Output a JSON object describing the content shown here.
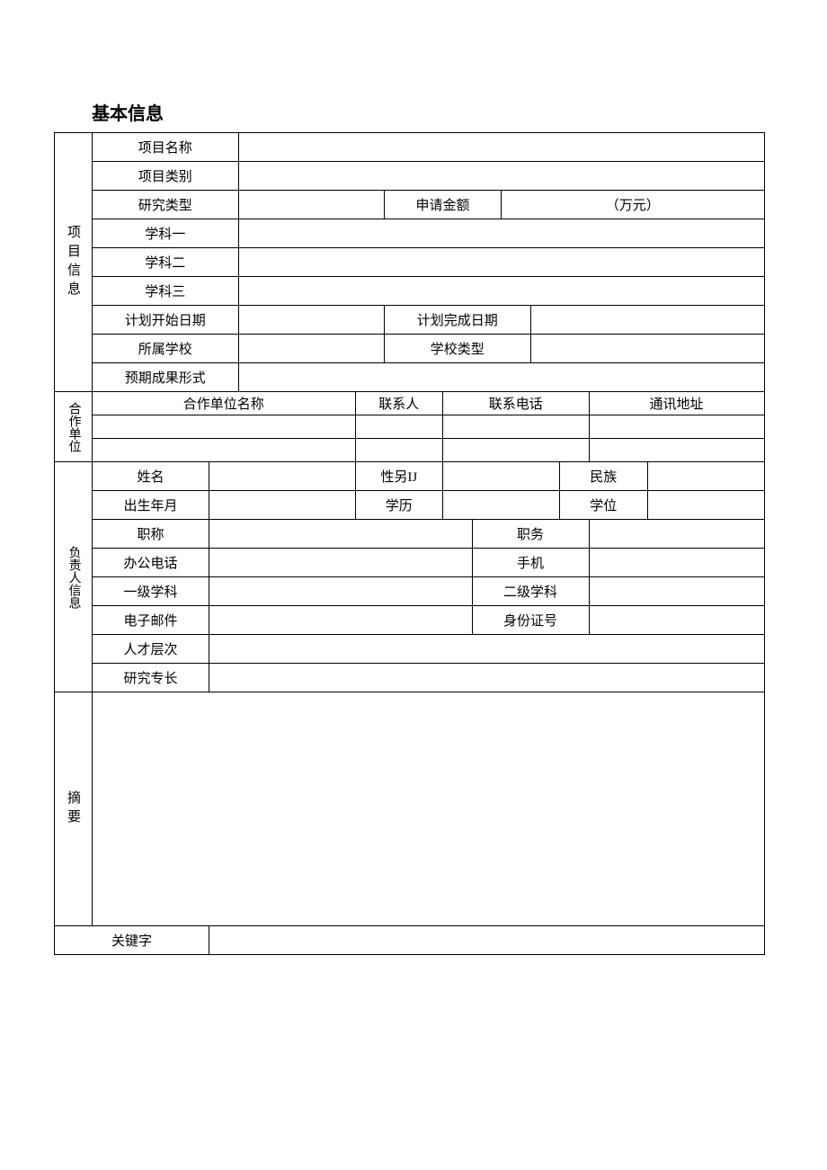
{
  "title": "基本信息",
  "project": {
    "section_label": "项目信息",
    "name_label": "项目名称",
    "name_value": "",
    "category_label": "项目类别",
    "category_value": "",
    "research_type_label": "研究类型",
    "research_type_value": "",
    "apply_amount_label": "申请金额",
    "apply_amount_value": "（万元）",
    "subject1_label": "学科一",
    "subject1_value": "",
    "subject2_label": "学科二",
    "subject2_value": "",
    "subject3_label": "学科三",
    "subject3_value": "",
    "plan_start_label": "计划开始日期",
    "plan_start_value": "",
    "plan_end_label": "计划完成日期",
    "plan_end_value": "",
    "school_label": "所属学校",
    "school_value": "",
    "school_type_label": "学校类型",
    "school_type_value": "",
    "expected_result_label": "预期成果形式",
    "expected_result_value": ""
  },
  "coop": {
    "section_label": "合作单位",
    "unit_name_label": "合作单位名称",
    "contact_label": "联系人",
    "phone_label": "联系电话",
    "address_label": "通讯地址",
    "rows": [
      {
        "unit": "",
        "contact": "",
        "phone": "",
        "address": ""
      },
      {
        "unit": "",
        "contact": "",
        "phone": "",
        "address": ""
      }
    ]
  },
  "person": {
    "section_label": "负责人信息",
    "name_label": "姓名",
    "name_value": "",
    "gender_label": "性另IJ",
    "gender_value": "",
    "ethnic_label": "民族",
    "ethnic_value": "",
    "birth_label": "出生年月",
    "birth_value": "",
    "edu_label": "学历",
    "edu_value": "",
    "degree_label": "学位",
    "degree_value": "",
    "title_label": "职称",
    "title_value": "",
    "duty_label": "职务",
    "duty_value": "",
    "office_phone_label": "办公电话",
    "office_phone_value": "",
    "mobile_label": "手机",
    "mobile_value": "",
    "subject1_label": "一级学科",
    "subject1_value": "",
    "subject2_label": "二级学科",
    "subject2_value": "",
    "email_label": "电子邮件",
    "email_value": "",
    "id_label": "身份证号",
    "id_value": "",
    "talent_label": "人才层次",
    "talent_value": "",
    "specialty_label": "研究专长",
    "specialty_value": ""
  },
  "abstract": {
    "section_label": "摘要",
    "value": ""
  },
  "keywords": {
    "label": "关键字",
    "value": ""
  }
}
